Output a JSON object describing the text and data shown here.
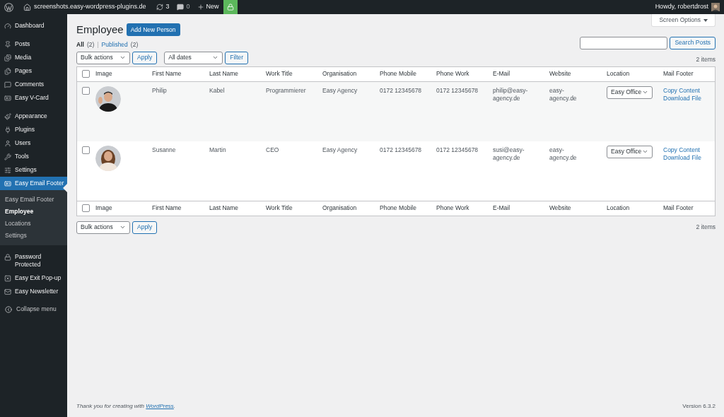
{
  "admin_bar": {
    "site_name": "screenshots.easy-wordpress-plugins.de",
    "updates": "3",
    "comments": "0",
    "new": "New",
    "greeting": "Howdy, robertdrost"
  },
  "sidebar": {
    "groups": [
      {
        "items": [
          {
            "label": "Dashboard",
            "selected": false
          }
        ]
      },
      {
        "items": [
          {
            "label": "Posts",
            "selected": false
          },
          {
            "label": "Media",
            "selected": false
          },
          {
            "label": "Pages",
            "selected": false
          },
          {
            "label": "Comments",
            "selected": false
          },
          {
            "label": "Easy V-Card",
            "selected": false
          }
        ]
      },
      {
        "items": [
          {
            "label": "Appearance",
            "selected": false
          },
          {
            "label": "Plugins",
            "selected": false
          },
          {
            "label": "Users",
            "selected": false
          },
          {
            "label": "Tools",
            "selected": false
          },
          {
            "label": "Settings",
            "selected": false
          },
          {
            "label": "Easy Email Footer",
            "selected": true,
            "children": [
              {
                "label": "Easy Email Footer",
                "selected": false
              },
              {
                "label": "Employee",
                "selected": true
              },
              {
                "label": "Locations",
                "selected": false
              },
              {
                "label": "Settings",
                "selected": false
              }
            ]
          }
        ]
      },
      {
        "items": [
          {
            "label": "Password Protected",
            "selected": false
          },
          {
            "label": "Easy Exit Pop-up",
            "selected": false
          },
          {
            "label": "Easy Newsletter",
            "selected": false
          }
        ]
      }
    ],
    "collapse": "Collapse menu"
  },
  "page": {
    "title": "Employee",
    "add_button": "Add New Person",
    "screen_options": "Screen Options",
    "views": [
      {
        "label": "All",
        "count": "(2)",
        "selected": true
      },
      {
        "label": "Published",
        "count": "(2)",
        "selected": false
      }
    ],
    "views_separator": "|",
    "search_button": "Search Posts",
    "bulk_actions": "Bulk actions",
    "apply": "Apply",
    "dates": "All dates",
    "filter": "Filter",
    "items_top": "2 items",
    "bulk_actions_bottom": "Bulk actions",
    "apply_bottom": "Apply",
    "items_bottom": "2 items"
  },
  "table": {
    "header_checked": false,
    "footer_checked": false,
    "columns": [
      "Image",
      "First Name",
      "Last Name",
      "Work Title",
      "Organisation",
      "Phone Mobile",
      "Phone Work",
      "E-Mail",
      "Website",
      "Location",
      "Mail Footer"
    ],
    "footer_columns": [
      "Image",
      "First Name",
      "Last Name",
      "Work Title",
      "Organisation",
      "Phone Mobile",
      "Phone Work",
      "E-Mail",
      "Website",
      "Location",
      "Mail Footer"
    ],
    "rows": [
      {
        "checked": false,
        "image": {
          "kind": "picture"
        },
        "first_name": "Philip",
        "last_name": "Kabel",
        "work_title": "Programmierer",
        "organisation": "Easy Agency",
        "phone_mobile": "0172 12345678",
        "phone_work": "0172 12345678",
        "email": "philip@easy-agency.de",
        "website": "easy-agency.de",
        "location": "Easy Office",
        "links": [
          "Copy Content",
          "Download File"
        ]
      },
      {
        "checked": false,
        "image": {
          "kind": "picture"
        },
        "first_name": "Susanne",
        "last_name": "Martin",
        "work_title": "CEO",
        "organisation": "Easy Agency",
        "phone_mobile": "0172 12345678",
        "phone_work": "0172 12345678",
        "email": "susi@easy-agency.de",
        "website": "easy-agency.de",
        "location": "Easy Office",
        "links": [
          "Copy Content",
          "Download File"
        ]
      }
    ]
  },
  "footer": {
    "text": "Thank you for creating with ",
    "link": "WordPress",
    "end": ".",
    "version": "Version 6.3.2"
  }
}
